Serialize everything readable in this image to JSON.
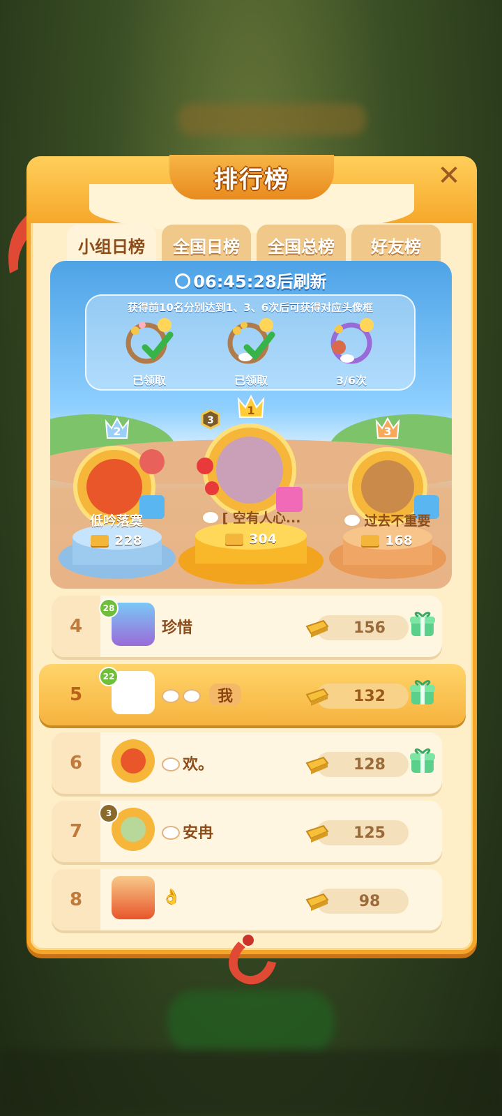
{
  "title": "排行榜",
  "tabs": [
    "小组日榜",
    "全国日榜",
    "全国总榜",
    "好友榜"
  ],
  "refresh": {
    "time": "06:45:28",
    "suffix": "后刷新"
  },
  "frames": {
    "hint": "获得前10名分别达到1、3、6次后可获得对应头像框",
    "items": [
      {
        "status": "已领取"
      },
      {
        "status": "已领取"
      },
      {
        "status": "3/6次"
      }
    ]
  },
  "podium": [
    {
      "rank": "2",
      "name": "低吟落寞",
      "score": "228",
      "level": ""
    },
    {
      "rank": "1",
      "name": "[ 空有人心...",
      "score": "304",
      "level": "3"
    },
    {
      "rank": "3",
      "name": "过去不重要",
      "score": "168",
      "level": ""
    }
  ],
  "list": [
    {
      "rank": "4",
      "name": "珍惜",
      "score": "156",
      "level": "28",
      "gift": true
    },
    {
      "rank": "5",
      "name": "",
      "me": "我",
      "score": "132",
      "level": "22",
      "gift": true
    },
    {
      "rank": "6",
      "name": "欢。",
      "score": "128",
      "level": "",
      "gift": true
    },
    {
      "rank": "7",
      "name": "安冉",
      "score": "125",
      "level": "3",
      "gift": false
    },
    {
      "rank": "8",
      "name": "👌",
      "score": "98",
      "level": "",
      "gift": false
    }
  ],
  "colors": {
    "panel": "#ffefc9",
    "accent": "#f4a52a",
    "gold": "#f3b53a"
  }
}
